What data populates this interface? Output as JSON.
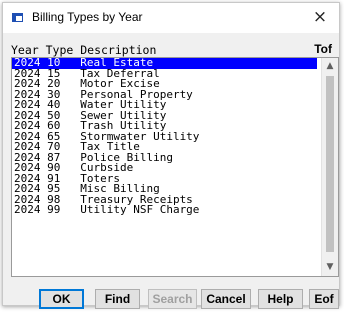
{
  "window": {
    "title": "Billing Types by Year",
    "close_glyph": "×"
  },
  "list": {
    "header": "Year Type Description",
    "tof_label": "Tof",
    "eof_label": "Eof",
    "selected_index": 0,
    "items": [
      "2024 10   Real Estate",
      "2024 15   Tax Deferral",
      "2024 20   Motor Excise",
      "2024 30   Personal Property",
      "2024 40   Water Utility",
      "2024 50   Sewer Utility",
      "2024 60   Trash Utility",
      "2024 65   Stormwater Utility",
      "2024 70   Tax Title",
      "2024 87   Police Billing",
      "2024 90   Curbside",
      "2024 91   Toters",
      "2024 95   Misc Billing",
      "2024 98   Treasury Receipts",
      "2024 99   Utility NSF Charge"
    ]
  },
  "buttons": {
    "ok": "OK",
    "find": "Find",
    "search": "Search",
    "cancel": "Cancel",
    "help": "Help"
  },
  "icons": {
    "app": "window-app-icon",
    "close": "close-icon",
    "scroll_up": "chevron-up-icon",
    "scroll_down": "chevron-down-icon"
  },
  "colors": {
    "selection": "#0000ff",
    "window_bg": "#f0f0f0"
  }
}
